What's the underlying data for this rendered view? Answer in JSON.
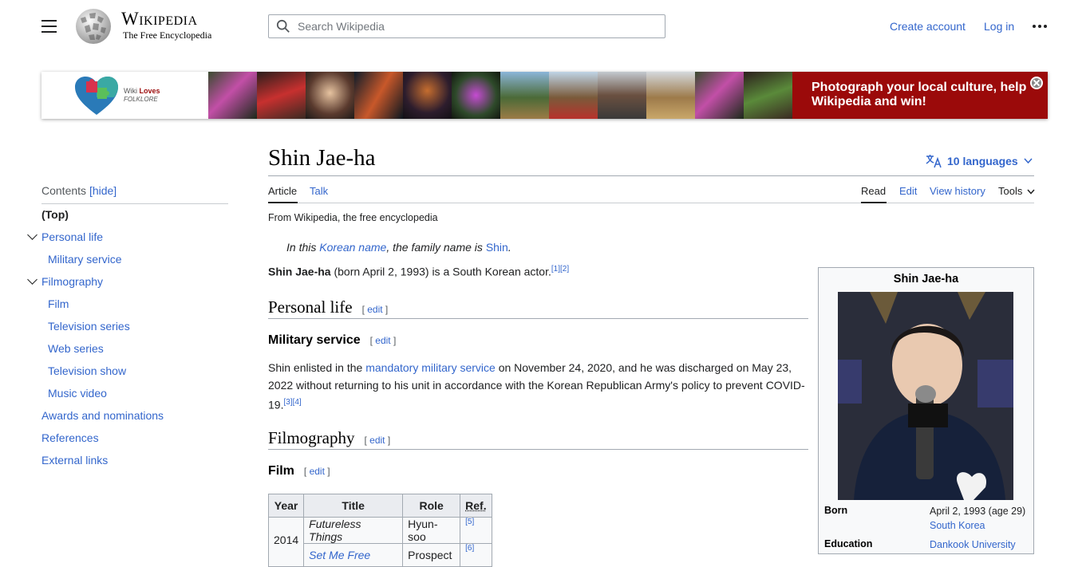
{
  "header": {
    "wordmark": "Wikipedia",
    "tagline": "The Free Encyclopedia",
    "search_placeholder": "Search Wikipedia",
    "create_account": "Create account",
    "log_in": "Log in"
  },
  "banner": {
    "logo_line1_a": "Wiki",
    "logo_line1_b": "Loves",
    "logo_line2": "FOLKLORE",
    "cta": "Photograph your local culture, help Wikipedia and win!"
  },
  "toc": {
    "heading": "Contents",
    "hide": "[hide]",
    "items": [
      {
        "label": "(Top)"
      },
      {
        "label": "Personal life"
      },
      {
        "label": "Military service"
      },
      {
        "label": "Filmography"
      },
      {
        "label": "Film"
      },
      {
        "label": "Television series"
      },
      {
        "label": "Web series"
      },
      {
        "label": "Television show"
      },
      {
        "label": "Music video"
      },
      {
        "label": "Awards and nominations"
      },
      {
        "label": "References"
      },
      {
        "label": "External links"
      }
    ]
  },
  "article": {
    "title": "Shin Jae-ha",
    "languages": "10 languages",
    "tabs": {
      "article": "Article",
      "talk": "Talk",
      "read": "Read",
      "edit": "Edit",
      "history": "View history",
      "tools": "Tools"
    },
    "from": "From Wikipedia, the free encyclopedia",
    "hatnote": {
      "pre": "In this ",
      "link1": "Korean name",
      "mid": ", the family name is ",
      "link2": "Shin",
      "post": "."
    },
    "intro": {
      "bold": "Shin Jae-ha",
      "rest": " (born April 2, 1993) is a South Korean actor.",
      "refs": "[1][2]"
    },
    "edit_label": "edit",
    "sections": {
      "personal_life": "Personal life",
      "military_service": "Military service",
      "filmography": "Filmography",
      "film": "Film"
    },
    "military": {
      "pre": "Shin enlisted in the ",
      "link": "mandatory military service",
      "post": " on November 24, 2020, and he was discharged on May 23, 2022 without returning to his unit in accordance with the Korean Republican Army's policy to prevent COVID-19.",
      "refs": "[3][4]"
    },
    "film_table": {
      "headers": [
        "Year",
        "Title",
        "Role",
        "Ref."
      ],
      "rows": [
        {
          "year": "2014",
          "title": "Futureless Things",
          "role": "Hyun-soo",
          "ref": "[5]"
        },
        {
          "title": "Set Me Free",
          "role": "Prospect",
          "ref": "[6]"
        }
      ]
    }
  },
  "infobox": {
    "title": "Shin Jae-ha",
    "born_label": "Born",
    "born_value": "April 2, 1993 (age 29)",
    "born_place": "South Korea",
    "education_label": "Education",
    "education_value": "Dankook University"
  },
  "colors": {
    "link": "#3366cc",
    "banner_red": "#9b0a0a"
  }
}
